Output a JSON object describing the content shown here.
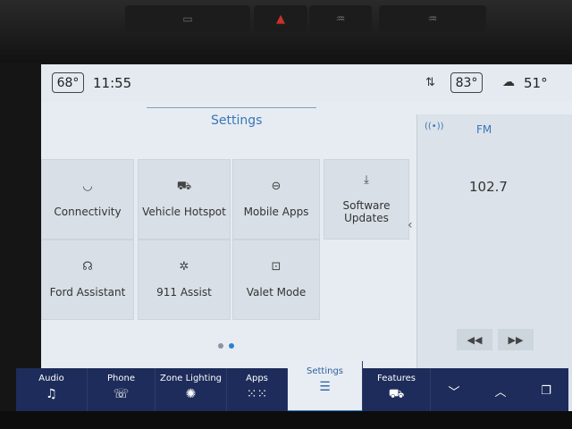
{
  "status": {
    "cabin_temp": "68°",
    "time": "11:55",
    "climate_temp": "83°",
    "outside_temp": "51°"
  },
  "settings_title": "Settings",
  "tiles": [
    {
      "label": "Connectivity",
      "icon": "wifi-icon"
    },
    {
      "label": "Vehicle Hotspot",
      "icon": "car-wifi-icon"
    },
    {
      "label": "Mobile Apps",
      "icon": "link-icon"
    },
    {
      "label": "Software\nUpdates",
      "icon": "download-icon"
    },
    {
      "label": "Ford Assistant",
      "icon": "voice-icon"
    },
    {
      "label": "911 Assist",
      "icon": "assist-icon"
    },
    {
      "label": "Valet Mode",
      "icon": "lock-icon"
    }
  ],
  "radio": {
    "band": "FM",
    "frequency": "102.7"
  },
  "nav": {
    "audio": "Audio",
    "phone": "Phone",
    "zone_lighting": "Zone Lighting",
    "apps": "Apps",
    "settings": "Settings",
    "features": "Features"
  },
  "colors": {
    "accent": "#3b76b8",
    "nav_bg": "#1d2c5a",
    "screen_bg": "#e6ecf2"
  }
}
